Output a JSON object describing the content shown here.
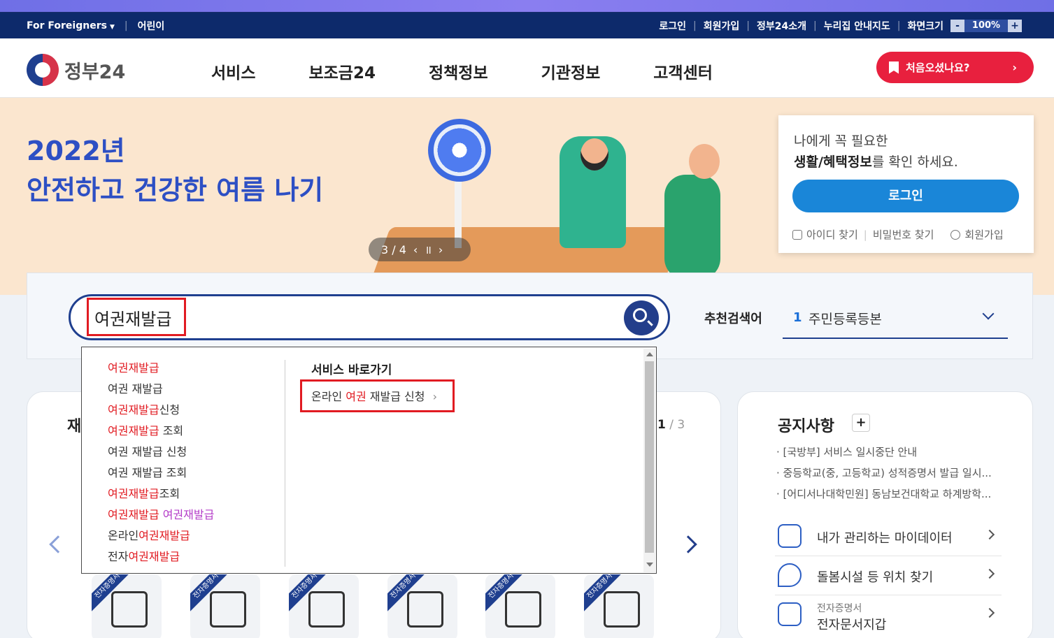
{
  "topbar": {
    "foreigners": "For Foreigners",
    "kids": "어린이",
    "links": [
      "로그인",
      "회원가입",
      "정부24소개",
      "누리집 안내지도"
    ],
    "zoom_label": "화면크기",
    "zoom_minus": "-",
    "zoom_value": "100%",
    "zoom_plus": "+"
  },
  "header": {
    "logo_text": "정부24",
    "nav": [
      "서비스",
      "보조금24",
      "정책정보",
      "기관정보",
      "고객센터"
    ],
    "first_visit": "처음오셨나요?"
  },
  "banner": {
    "title_line1": "2022년",
    "title_line2": "안전하고 건강한 여름 나기",
    "carousel_position": "3 / 4"
  },
  "login_card": {
    "msg_line1": "나에게 꼭 필요한",
    "msg_bold": "생활/혜택정보",
    "msg_rest": "를 확인 하세요.",
    "login_button": "로그인",
    "find_id": "아이디 찾기",
    "find_pw": "비밀번호 찾기",
    "signup": "회원가입"
  },
  "search": {
    "value": "여권재발급",
    "recommend_label": "추천검색어",
    "recommend_rank": "1",
    "recommend_text": "주민등록등본"
  },
  "autocomplete": {
    "suggestions": [
      {
        "hl": "여권재발급",
        "rest": "",
        "pre": ""
      },
      {
        "hl": "",
        "rest": "여권 재발급",
        "pre": ""
      },
      {
        "hl": "여권재발급",
        "rest": "신청",
        "pre": ""
      },
      {
        "hl": "여권재발급",
        "rest": " 조회",
        "pre": ""
      },
      {
        "hl": "",
        "rest": "여권 재발급 신청",
        "pre": ""
      },
      {
        "hl": "",
        "rest": "여권 재발급 조회",
        "pre": ""
      },
      {
        "hl": "여권재발급",
        "rest": "조회",
        "pre": ""
      },
      {
        "hl": "여권재발급",
        "rest": " 여권재발급",
        "pre": ""
      },
      {
        "hl": "여권재발급",
        "rest": "",
        "pre": "온라인"
      },
      {
        "hl": "여권재발급",
        "rest": "",
        "pre": "전자"
      }
    ],
    "shortcut_heading": "서비스 바로가기",
    "shortcut_pre": "온라인 ",
    "shortcut_hl": "여권",
    "shortcut_post": " 재발급 신청",
    "shortcut_chev": "›"
  },
  "services_card": {
    "title_partial": "재",
    "pager_current": "1",
    "pager_total": "/ 3",
    "badge": "전자증명서"
  },
  "notice_card": {
    "title": "공지사항",
    "plus": "+",
    "items": [
      "[국방부] 서비스 일시중단 안내",
      "중등학교(중, 고등학교) 성적증명서 발급 일시...",
      "[어디서나대학민원] 동남보건대학교 하계방학..."
    ],
    "quick_links": [
      "내가 관리하는 마이데이터",
      "돌봄시설 등 위치 찾기"
    ],
    "wallet_sub": "전자증명서",
    "wallet_label": "전자문서지갑"
  },
  "colors": {
    "navy": "#0d2a6b",
    "accent_red": "#e8203e",
    "primary_blue": "#1a86d8",
    "highlight_red": "#e11b22"
  }
}
